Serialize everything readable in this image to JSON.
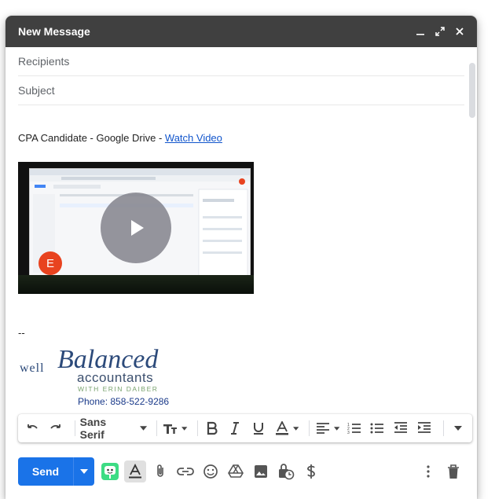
{
  "compose": {
    "title": "New Message",
    "recipients_placeholder": "Recipients",
    "subject_placeholder": "Subject"
  },
  "body": {
    "line_prefix": "CPA Candidate - Google Drive - ",
    "link_text": "Watch Video",
    "video_avatar_letter": "E",
    "signature_dash": "--",
    "phone": "Phone:  858-522-9286"
  },
  "logo": {
    "word1": "well",
    "word2": "Balanced",
    "word3": "accountants",
    "tagline": "WITH ERIN DAIBER"
  },
  "toolbar": {
    "font_name": "Sans Serif"
  },
  "bottom": {
    "send_label": "Send"
  },
  "colors": {
    "title_bar": "#404040",
    "send": "#1a73e8",
    "link": "#1155cc"
  }
}
